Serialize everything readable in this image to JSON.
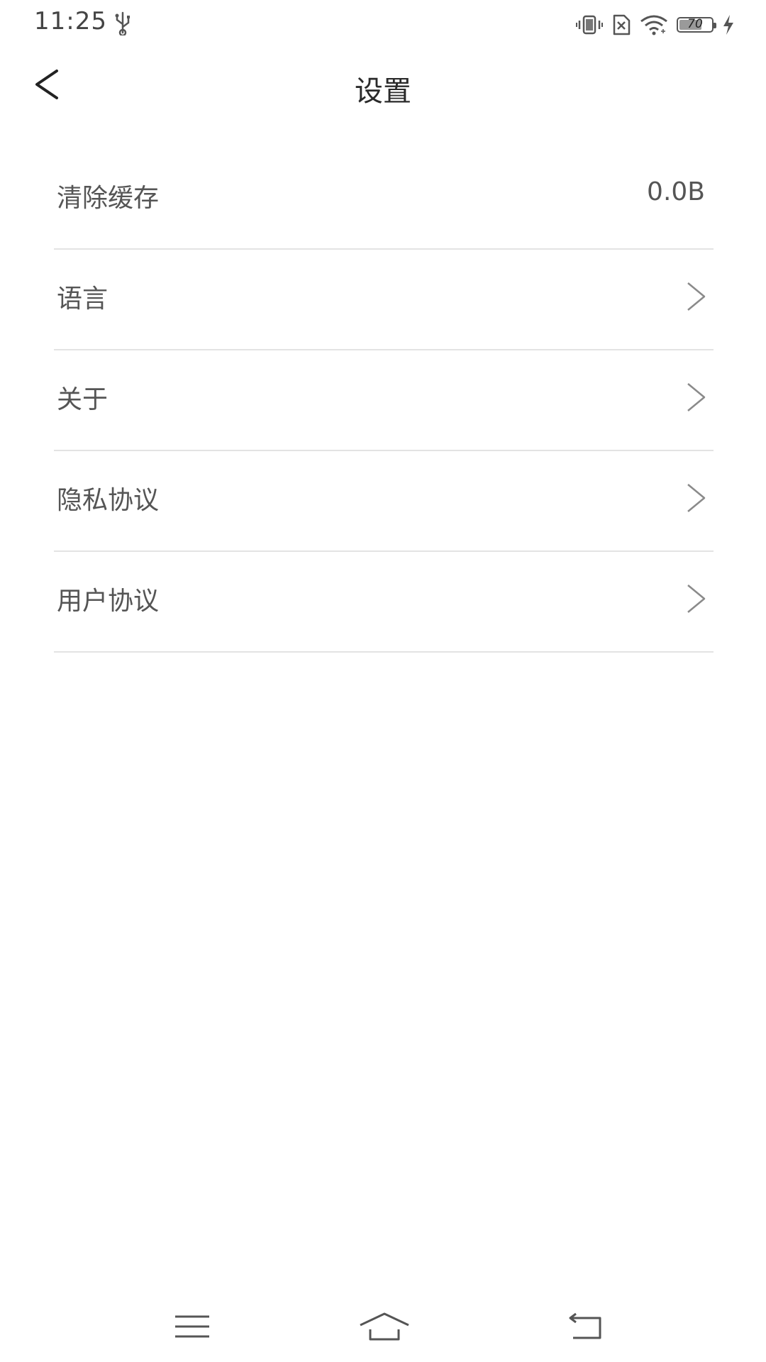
{
  "status_bar": {
    "time": "11:25",
    "battery_level": "70",
    "battery_fraction": 0.7,
    "icons": [
      "usb-icon",
      "vibrate-icon",
      "no-sim-icon",
      "wifi-icon",
      "battery-icon",
      "charging-icon"
    ]
  },
  "header": {
    "title": "设置",
    "back_icon": "chevron-left-icon"
  },
  "settings": {
    "items": [
      {
        "label": "清除缓存",
        "value": "0.0B"
      },
      {
        "label": "语言"
      },
      {
        "label": "关于"
      },
      {
        "label": "隐私协议"
      },
      {
        "label": "用户协议"
      }
    ]
  },
  "system_nav": {
    "icons": [
      "menu-icon",
      "home-icon",
      "back-icon"
    ]
  },
  "colors": {
    "background": "#ffffff",
    "text_primary": "#2a2a2a",
    "text_secondary": "#555555",
    "divider": "#e3e3e3",
    "chevron": "#8a8a8a"
  }
}
